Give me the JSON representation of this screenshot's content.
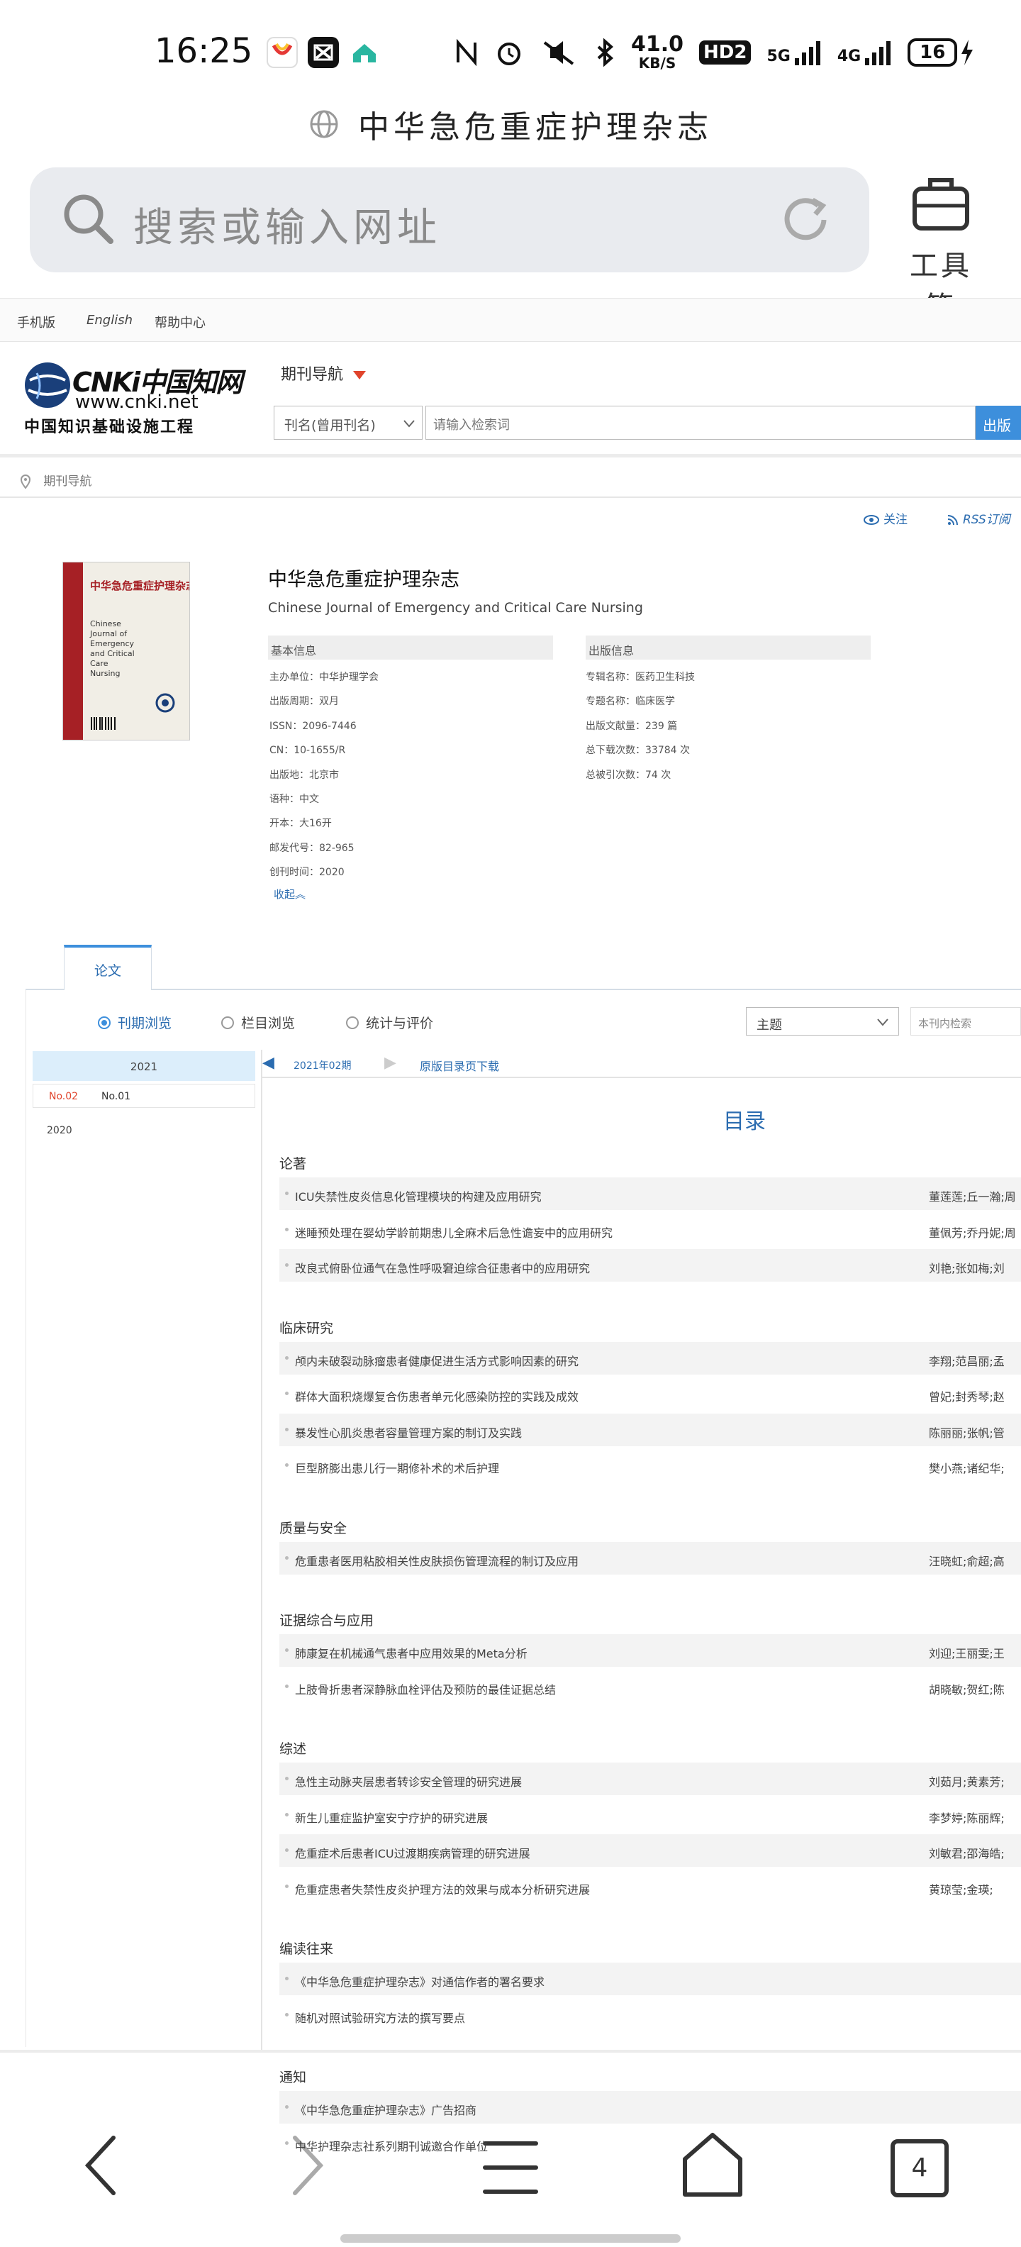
{
  "status_bar": {
    "time": "16:25",
    "speed_value": "41.0",
    "speed_unit": "KB/S",
    "hd": "HD2",
    "net1": "5G",
    "net2": "4G",
    "battery": "16"
  },
  "browser": {
    "page_title": "中华急危重症护理杂志",
    "search_placeholder": "搜索或输入网址",
    "toolbox_label": "工具箱"
  },
  "cnki_header": {
    "top_links": [
      "手机版",
      "English",
      "帮助中心"
    ],
    "logo_text": "CNKi中国知网",
    "logo_url": "www.cnki.net",
    "logo_sub": "中国知识基础设施工程",
    "journal_nav": "期刊导航",
    "select_value": "刊名(曾用刊名)",
    "search_placeholder": "请输入检索词",
    "search_button": "出版",
    "breadcrumb": "期刊导航"
  },
  "journal": {
    "follow": "关注",
    "rss": "RSS订阅",
    "cover_title": "中华急危重症护理杂志",
    "cover_en": "Chinese Journal of Emergency and Critical Care Nursing",
    "title": "中华急危重症护理杂志",
    "title_en": "Chinese Journal of Emergency and Critical Care Nursing",
    "basic_header": "基本信息",
    "publish_header": "出版信息",
    "basic": [
      "主办单位：中华护理学会",
      "出版周期：双月",
      "ISSN：2096-7446",
      "CN：10-1655/R",
      "出版地：北京市",
      "语种：中文",
      "开本：大16开",
      "邮发代号：82-965",
      "创刊时间：2020"
    ],
    "publish": [
      "专辑名称：医药卫生科技",
      "专题名称：临床医学",
      "出版文献量：239 篇",
      "总下载次数：33784 次",
      "总被引次数：74 次"
    ],
    "collapse": "收起︽"
  },
  "tabs": {
    "active": "论文"
  },
  "browse": {
    "options": [
      "刊期浏览",
      "栏目浏览",
      "统计与评价"
    ],
    "theme_select": "主题",
    "inner_search": "本刊内检索",
    "year_current": "2021",
    "issues": [
      "No.02",
      "No.01"
    ],
    "year_other": "2020",
    "current_issue": "2021年02期",
    "download": "原版目录页下载",
    "toc_title": "目录"
  },
  "toc": [
    {
      "section": "论著",
      "articles": [
        {
          "title": "ICU失禁性皮炎信息化管理模块的构建及应用研究",
          "authors": "董莲莲;丘一瀚;周"
        },
        {
          "title": "迷睡预处理在婴幼学龄前期患儿全麻术后急性谵妄中的应用研究",
          "authors": "董佩芳;乔丹妮;周"
        },
        {
          "title": "改良式俯卧位通气在急性呼吸窘迫综合征患者中的应用研究",
          "authors": "刘艳;张如梅;刘"
        }
      ]
    },
    {
      "section": "临床研究",
      "articles": [
        {
          "title": "颅内未破裂动脉瘤患者健康促进生活方式影响因素的研究",
          "authors": "李翔;范昌丽;孟"
        },
        {
          "title": "群体大面积烧爆复合伤患者单元化感染防控的实践及成效",
          "authors": "曾妃;封秀琴;赵"
        },
        {
          "title": "暴发性心肌炎患者容量管理方案的制订及实践",
          "authors": "陈丽丽;张帆;管"
        },
        {
          "title": "巨型脐膨出患儿行一期修补术的术后护理",
          "authors": "樊小燕;诸纪华;"
        }
      ]
    },
    {
      "section": "质量与安全",
      "articles": [
        {
          "title": "危重患者医用粘胶相关性皮肤损伤管理流程的制订及应用",
          "authors": "汪晓虹;俞超;高"
        }
      ]
    },
    {
      "section": "证据综合与应用",
      "articles": [
        {
          "title": "肺康复在机械通气患者中应用效果的Meta分析",
          "authors": "刘迎;王丽雯;王"
        },
        {
          "title": "上肢骨折患者深静脉血栓评估及预防的最佳证据总结",
          "authors": "胡晓敏;贺红;陈"
        }
      ]
    },
    {
      "section": "综述",
      "articles": [
        {
          "title": "急性主动脉夹层患者转诊安全管理的研究进展",
          "authors": "刘茹月;黄素芳;"
        },
        {
          "title": "新生儿重症监护室安宁疗护的研究进展",
          "authors": "李梦婷;陈丽辉;"
        },
        {
          "title": "危重症术后患者ICU过渡期疾病管理的研究进展",
          "authors": "刘敏君;邵海皓;"
        },
        {
          "title": "危重症患者失禁性皮炎护理方法的效果与成本分析研究进展",
          "authors": "黄琼莹;金瑛;"
        }
      ]
    },
    {
      "section": "编读往来",
      "articles": [
        {
          "title": "《中华急危重症护理杂志》对通信作者的署名要求",
          "authors": ""
        },
        {
          "title": "随机对照试验研究方法的撰写要点",
          "authors": ""
        }
      ]
    },
    {
      "section": "通知",
      "articles": [
        {
          "title": "《中华急危重症护理杂志》广告招商",
          "authors": ""
        },
        {
          "title": "中华护理杂志社系列期刊诚邀合作单位",
          "authors": ""
        }
      ]
    }
  ],
  "bottom_nav": {
    "tabs_count": "4"
  }
}
